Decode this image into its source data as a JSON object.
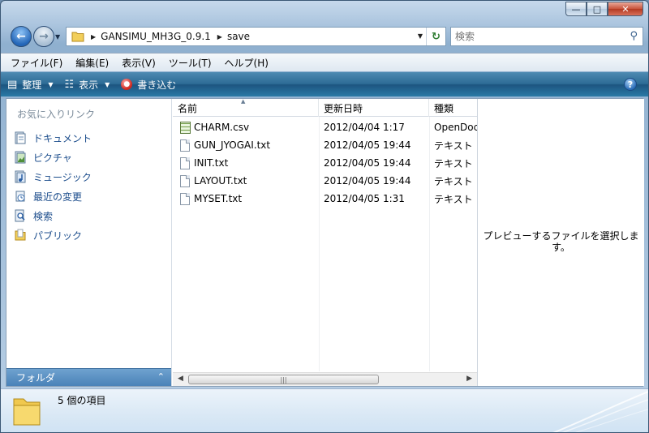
{
  "address": {
    "crumbs": [
      "GANSIMU_MH3G_0.9.1",
      "save"
    ]
  },
  "search": {
    "placeholder": "検索"
  },
  "menu": [
    "ファイル(F)",
    "編集(E)",
    "表示(V)",
    "ツール(T)",
    "ヘルプ(H)"
  ],
  "toolbar": {
    "organize": "整理",
    "views": "表示",
    "burn": "書き込む"
  },
  "nav": {
    "title": "お気に入りリンク",
    "items": [
      {
        "label": "ドキュメント",
        "icon": "documents-icon"
      },
      {
        "label": "ピクチャ",
        "icon": "pictures-icon"
      },
      {
        "label": "ミュージック",
        "icon": "music-icon"
      },
      {
        "label": "最近の変更",
        "icon": "recent-changes-icon"
      },
      {
        "label": "検索",
        "icon": "search-folder-icon"
      },
      {
        "label": "パブリック",
        "icon": "public-folder-icon"
      }
    ],
    "folder_bar": "フォルダ"
  },
  "columns": {
    "name": "名前",
    "date": "更新日時",
    "type": "種類"
  },
  "files": [
    {
      "name": "CHARM.csv",
      "date": "2012/04/04 1:17",
      "type": "OpenDocu",
      "icon": "csv-file-icon"
    },
    {
      "name": "GUN_JYOGAI.txt",
      "date": "2012/04/05 19:44",
      "type": "テキスト",
      "icon": "text-file-icon"
    },
    {
      "name": "INIT.txt",
      "date": "2012/04/05 19:44",
      "type": "テキスト",
      "icon": "text-file-icon"
    },
    {
      "name": "LAYOUT.txt",
      "date": "2012/04/05 19:44",
      "type": "テキスト",
      "icon": "text-file-icon"
    },
    {
      "name": "MYSET.txt",
      "date": "2012/04/05 1:31",
      "type": "テキスト",
      "icon": "text-file-icon"
    }
  ],
  "preview": {
    "message": "プレビューするファイルを選択します。"
  },
  "details": {
    "count": "5 個の項目"
  }
}
